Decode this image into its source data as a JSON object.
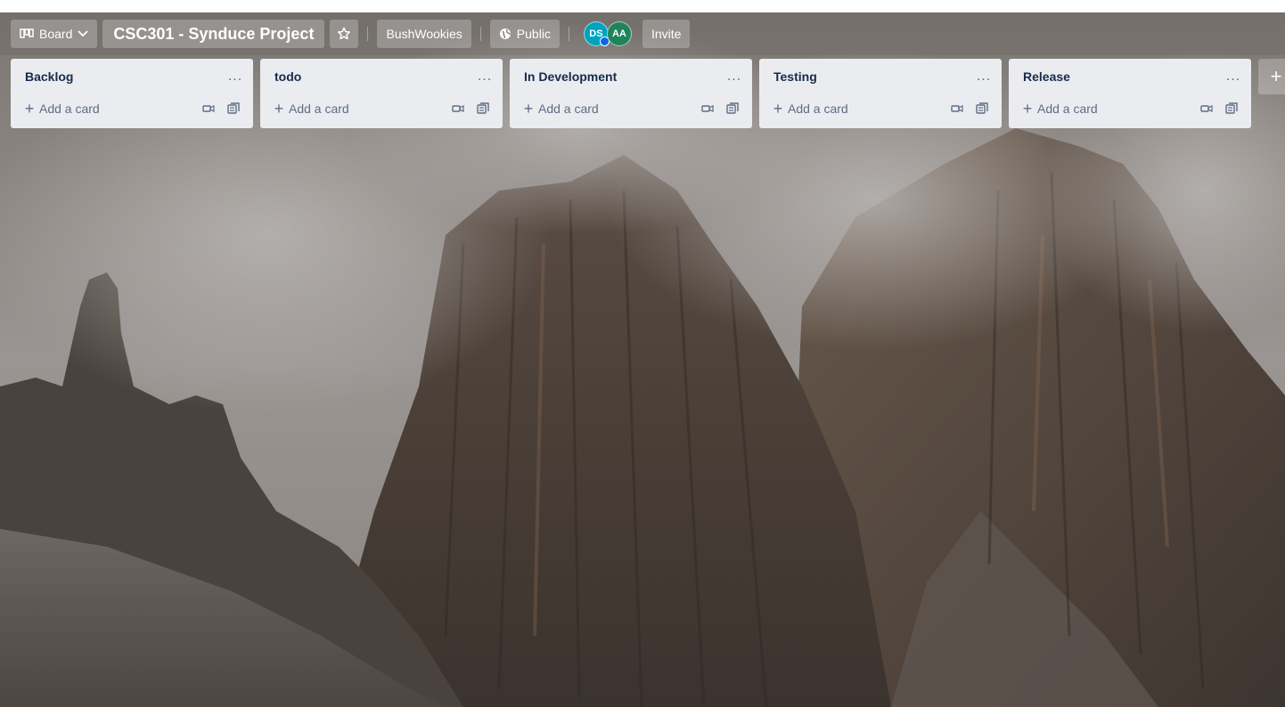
{
  "header": {
    "view_label": "Board",
    "board_title": "CSC301 - Synduce Project",
    "workspace_label": "BushWookies",
    "visibility_label": "Public",
    "invite_label": "Invite",
    "members": [
      {
        "initials": "DS",
        "color": "#00a3bf"
      },
      {
        "initials": "AA",
        "color": "#1f845a"
      }
    ]
  },
  "lists": [
    {
      "title": "Backlog",
      "menu": "...",
      "add_card_label": "Add a card"
    },
    {
      "title": "todo",
      "menu": "...",
      "add_card_label": "Add a card"
    },
    {
      "title": "In Development",
      "menu": "...",
      "add_card_label": "Add a card"
    },
    {
      "title": "Testing",
      "menu": "...",
      "add_card_label": "Add a card"
    },
    {
      "title": "Release",
      "menu": "...",
      "add_card_label": "Add a card"
    }
  ],
  "add_list_symbol": "+",
  "icons": {
    "view": "board-icon",
    "view_chevron": "chevron-down-icon",
    "star": "star-icon",
    "visibility": "globe-icon",
    "add": "plus-icon",
    "list_menu": "more-horizontal-icon",
    "card_video": "video-icon",
    "card_template": "template-icon"
  },
  "colors": {
    "list_bg": "#ebecf0",
    "list_title": "#172b4d",
    "muted_text": "#5e6c84"
  }
}
